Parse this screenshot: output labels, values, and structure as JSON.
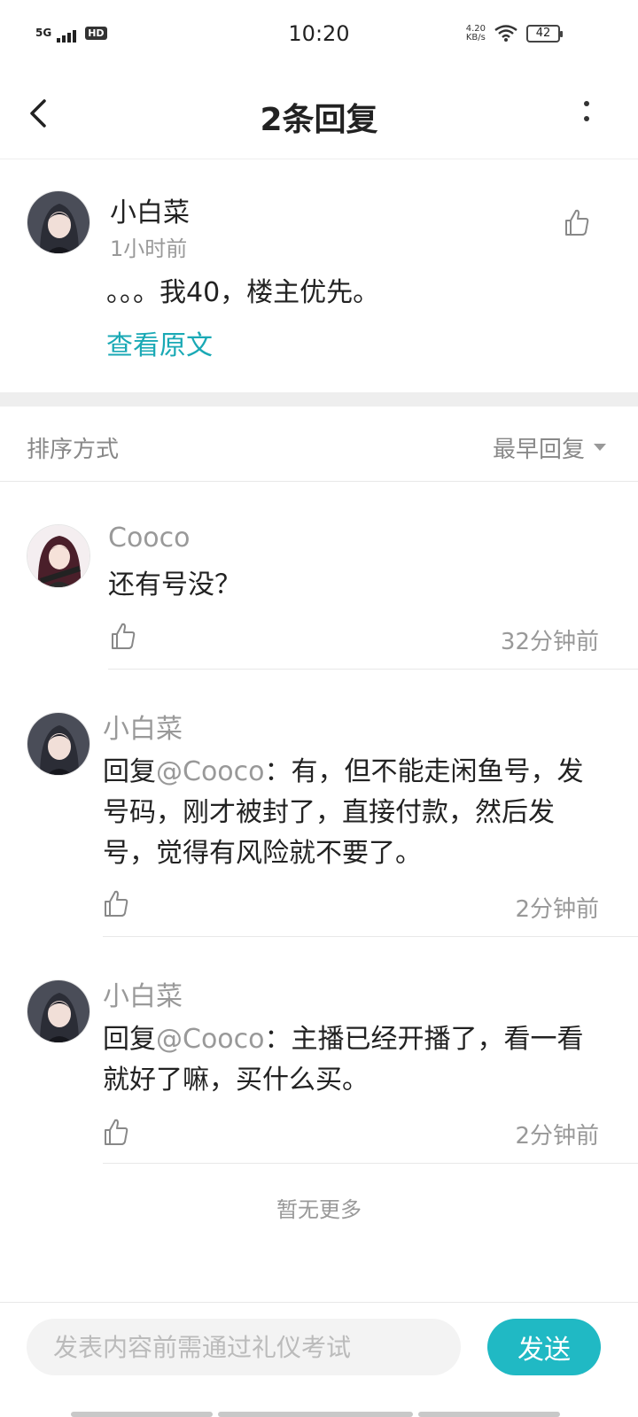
{
  "status_bar": {
    "network": "5G",
    "hd_badge": "HD",
    "time": "10:20",
    "speed_value": "4.20",
    "speed_unit": "KB/s",
    "battery": "42"
  },
  "header": {
    "title": "2条回复",
    "back_icon": "chevron-left-icon",
    "more_icon": "vertical-dots-icon"
  },
  "original_comment": {
    "author": "小白菜",
    "time": "1小时前",
    "text": "。。。我40，楼主优先。",
    "view_original_label": "查看原文",
    "like_icon": "thumbs-up-icon"
  },
  "sort": {
    "label": "排序方式",
    "value": "最早回复"
  },
  "replies": [
    {
      "author": "Cooco",
      "text_prefix": "",
      "mention": "",
      "text": "还有号没？",
      "time": "32分钟前"
    },
    {
      "author": "小白菜",
      "text_prefix": "回复",
      "mention": "@Cooco",
      "text": "：有，但不能走闲鱼号，发号码，刚才被封了，直接付款，然后发号，觉得有风险就不要了。",
      "time": "2分钟前"
    },
    {
      "author": "小白菜",
      "text_prefix": "回复",
      "mention": "@Cooco",
      "text": "：主播已经开播了，看一看就好了嘛，买什么买。",
      "time": "2分钟前"
    }
  ],
  "no_more_text": "暂无更多",
  "composer": {
    "placeholder": "发表内容前需通过礼仪考试",
    "send_label": "发送"
  },
  "colors": {
    "accent": "#20b9c4",
    "link": "#1aa9b5",
    "muted_text": "#999999"
  }
}
